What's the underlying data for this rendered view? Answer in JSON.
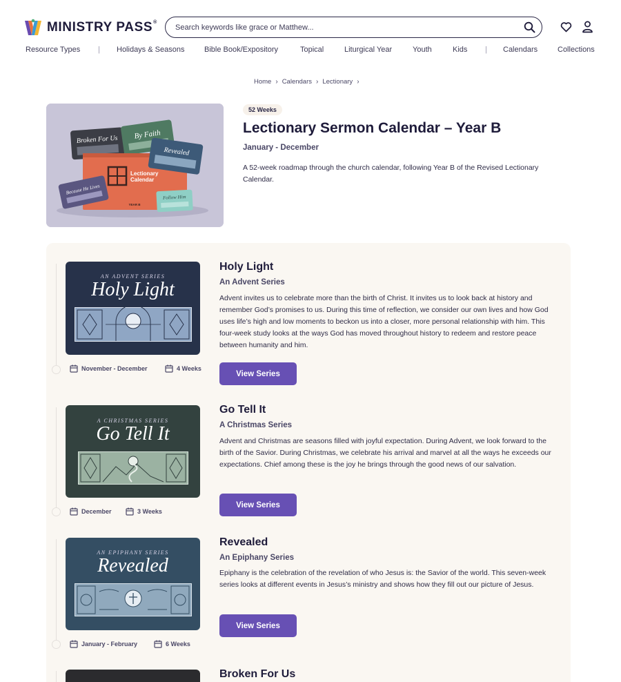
{
  "brand": {
    "name": "MINISTRY PASS",
    "registered": "®"
  },
  "search": {
    "placeholder": "Search keywords like grace or Matthew..."
  },
  "nav": {
    "items": [
      "Resource Types",
      "Holidays & Seasons",
      "Bible Book/Expository",
      "Topical",
      "Liturgical Year",
      "Youth",
      "Kids",
      "Calendars",
      "Collections"
    ],
    "separator": "|"
  },
  "breadcrumb": [
    "Home",
    "Calendars",
    "Lectionary"
  ],
  "hero": {
    "badge": "52 Weeks",
    "title": "Lectionary Sermon Calendar – Year B",
    "subtitle": "January - December",
    "description": "A 52-week roadmap through the church calendar, following Year B of the Revised Lectionary Calendar.",
    "image_text": {
      "cover": "Lectionary\nCalendar",
      "year": "YEAR B",
      "cards": [
        "Broken For Us",
        "By Faith",
        "Revealed",
        "Because He Lives",
        "Follow Him"
      ]
    }
  },
  "series": [
    {
      "kicker": "AN ADVENT SERIES",
      "card_title": "Holy Light",
      "title": "Holy Light",
      "subtitle": "An Advent Series",
      "description": "Advent invites us to celebrate more than the birth of Christ. It invites us to look back at history and remember God’s promises to us. During this time of reflection, we consider our own lives and how God uses life’s high and low moments to beckon us into a closer, more personal relationship with him. This four-week study looks at the ways God has moved throughout history to redeem and restore peace between humanity and him.",
      "dates": "November - December",
      "weeks": "4 Weeks",
      "button": "View Series",
      "color": "#27324a"
    },
    {
      "kicker": "A CHRISTMAS SERIES",
      "card_title": "Go Tell It",
      "title": "Go Tell It",
      "subtitle": "A Christmas Series",
      "description": "Advent and Christmas are seasons filled with joyful expectation. During Advent, we look forward to the birth of the Savior. During Christmas, we celebrate his arrival and marvel at all the ways he exceeds our expectations. Chief among these is the joy he brings through the good news of our salvation.",
      "dates": "December",
      "weeks": "3 Weeks",
      "button": "View Series",
      "color": "#33423f"
    },
    {
      "kicker": "AN EPIPHANY SERIES",
      "card_title": "Revealed",
      "title": "Revealed",
      "subtitle": "An Epiphany Series",
      "description": "Epiphany is the celebration of the revelation of who Jesus is: the Savior of the world. This seven-week series looks at different events in Jesus’s ministry and shows how they fill out our picture of Jesus.",
      "dates": "January - February",
      "weeks": "6 Weeks",
      "button": "View Series",
      "color": "#344e63"
    },
    {
      "title": "Broken For Us",
      "color": "#2b2b2e"
    }
  ],
  "colors": {
    "accent": "#6750b4",
    "ink": "#1e1b3a",
    "panel": "#faf7f2"
  }
}
